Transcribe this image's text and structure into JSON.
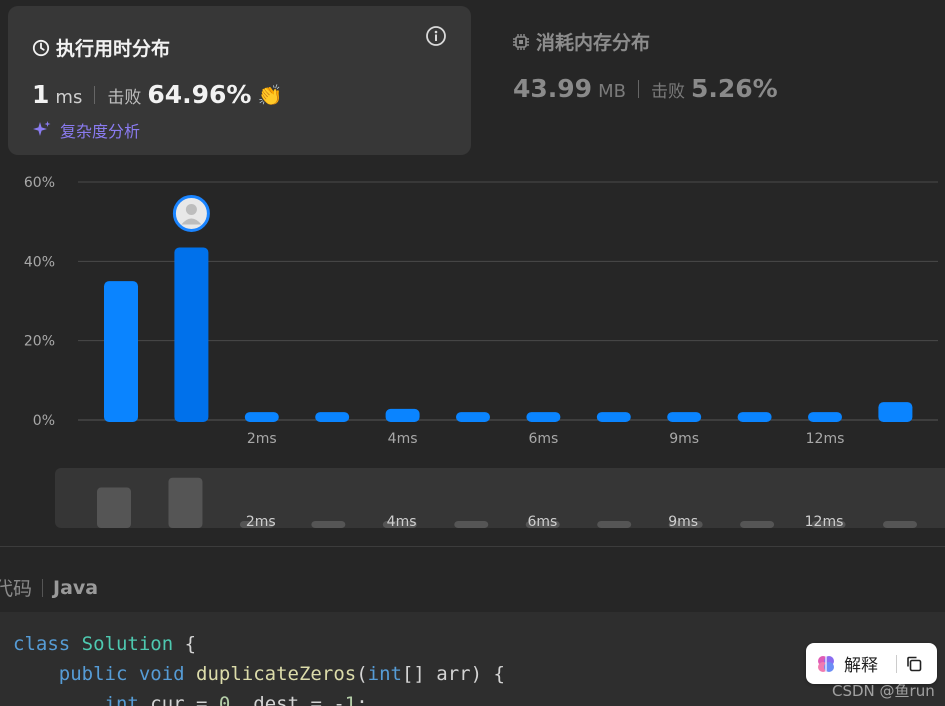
{
  "runtime": {
    "title": "执行用时分布",
    "value": "1",
    "unit": "ms",
    "beat_label": "击败",
    "beat_value": "64.96%",
    "complexity_link": "复杂度分析"
  },
  "memory": {
    "title": "消耗内存分布",
    "value": "43.99",
    "unit": "MB",
    "beat_label": "击败",
    "beat_value": "5.26%"
  },
  "colors": {
    "bar": "#0a84ff",
    "bar_user": "#0071eb",
    "beat_hands": "#1fa34a",
    "complexity": "#8a7bf0"
  },
  "chart_data": {
    "type": "bar",
    "yticks": [
      "60%",
      "40%",
      "20%",
      "0%"
    ],
    "ylim": [
      0,
      60
    ],
    "grid": true,
    "values": [
      35,
      43.5,
      2,
      2,
      2.8,
      2,
      2,
      2,
      2,
      2,
      2,
      4.5
    ],
    "user_bar_index": 1,
    "x_tick_labels": [
      {
        "index": 2,
        "label": "2ms"
      },
      {
        "index": 4,
        "label": "4ms"
      },
      {
        "index": 6,
        "label": "6ms"
      },
      {
        "index": 8,
        "label": "9ms"
      },
      {
        "index": 10,
        "label": "12ms"
      }
    ]
  },
  "code_section": {
    "title_fragment": "代码",
    "language": "Java",
    "lines": [
      [
        {
          "t": "kw",
          "v": "class "
        },
        {
          "t": "cls",
          "v": "Solution"
        },
        {
          "t": "txt",
          "v": " {"
        }
      ],
      [
        {
          "t": "txt",
          "v": "    "
        },
        {
          "t": "kw",
          "v": "public void "
        },
        {
          "t": "fn",
          "v": "duplicateZeros"
        },
        {
          "t": "txt",
          "v": "("
        },
        {
          "t": "kw",
          "v": "int"
        },
        {
          "t": "txt",
          "v": "[] arr) {"
        }
      ],
      [
        {
          "t": "txt",
          "v": "        "
        },
        {
          "t": "kw",
          "v": "int"
        },
        {
          "t": "txt",
          "v": " cur = "
        },
        {
          "t": "num",
          "v": "0"
        },
        {
          "t": "txt",
          "v": ", dest = -"
        },
        {
          "t": "num",
          "v": "1"
        },
        {
          "t": "txt",
          "v": ";"
        }
      ]
    ]
  },
  "explain_button": {
    "label": "解释"
  },
  "watermark": "CSDN @鱼run"
}
